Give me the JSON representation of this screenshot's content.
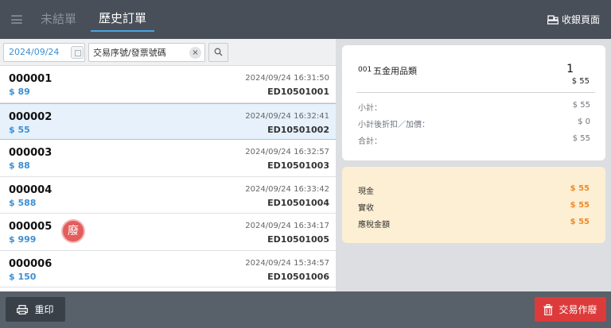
{
  "header": {
    "tabs": [
      {
        "label": "未結單",
        "active": false
      },
      {
        "label": "歷史訂單",
        "active": true
      }
    ],
    "register_label": "收銀頁面",
    "icons": {
      "menu": "hamburger-menu-icon",
      "register": "register-icon"
    }
  },
  "filter": {
    "date": "2024/09/24",
    "search_placeholder": "交易序號/發票號碼",
    "clear_symbol": "×"
  },
  "orders": [
    {
      "number": "000001",
      "amount": "$ 89",
      "datetime": "2024/09/24 16:31:50",
      "invoice": "ED10501001",
      "selected": false,
      "voided": false
    },
    {
      "number": "000002",
      "amount": "$ 55",
      "datetime": "2024/09/24 16:32:41",
      "invoice": "ED10501002",
      "selected": true,
      "voided": false
    },
    {
      "number": "000003",
      "amount": "$ 88",
      "datetime": "2024/09/24 16:32:57",
      "invoice": "ED10501003",
      "selected": false,
      "voided": false
    },
    {
      "number": "000004",
      "amount": "$ 588",
      "datetime": "2024/09/24 16:33:42",
      "invoice": "ED10501004",
      "selected": false,
      "voided": false
    },
    {
      "number": "000005",
      "amount": "$ 999",
      "datetime": "2024/09/24 16:34:17",
      "invoice": "ED10501005",
      "selected": false,
      "voided": true,
      "void_mark": "廢"
    },
    {
      "number": "000006",
      "amount": "$ 150",
      "datetime": "2024/09/24 15:34:57",
      "invoice": "ED10501006",
      "selected": false,
      "voided": false
    }
  ],
  "detail": {
    "item": {
      "code": "001",
      "name": "五金用品類",
      "qty": "1",
      "price": "$ 55"
    },
    "summary": [
      {
        "label": "小計：",
        "value": "$ 55"
      },
      {
        "label": "小計後折扣／加價：",
        "value": "$ 0"
      },
      {
        "label": "合計：",
        "value": "$ 55"
      }
    ],
    "payment": [
      {
        "label": "現金",
        "value": "$ 55"
      },
      {
        "label": "實收",
        "value": "$ 55"
      },
      {
        "label": "應稅金額",
        "value": "$ 55"
      }
    ]
  },
  "footer": {
    "reprint_label": "重印",
    "void_label": "交易作廢"
  },
  "colors": {
    "topbar": "#484f59",
    "accent_blue": "#3d8fd1",
    "void_red": "#dd3b3b",
    "payment_bg": "#fdefd3",
    "payment_value": "#ef8a2b"
  }
}
